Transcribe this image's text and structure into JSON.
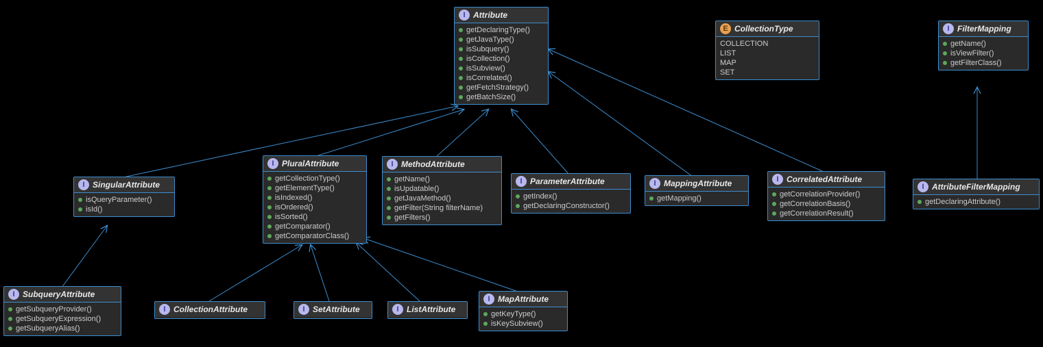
{
  "attribute": {
    "name": "Attribute",
    "m": [
      "getDeclaringType()",
      "getJavaType()",
      "isSubquery()",
      "isCollection()",
      "isSubview()",
      "isCorrelated()",
      "getFetchStrategy()",
      "getBatchSize()"
    ]
  },
  "collectionType": {
    "name": "CollectionType",
    "m": [
      "COLLECTION",
      "LIST",
      "MAP",
      "SET"
    ]
  },
  "filterMapping": {
    "name": "FilterMapping",
    "m": [
      "getName()",
      "isViewFilter()",
      "getFilterClass()"
    ]
  },
  "singularAttribute": {
    "name": "SingularAttribute",
    "m": [
      "isQueryParameter()",
      "isId()"
    ]
  },
  "pluralAttribute": {
    "name": "PluralAttribute",
    "m": [
      "getCollectionType()",
      "getElementType()",
      "isIndexed()",
      "isOrdered()",
      "isSorted()",
      "getComparator()",
      "getComparatorClass()"
    ]
  },
  "methodAttribute": {
    "name": "MethodAttribute",
    "m": [
      "getName()",
      "isUpdatable()",
      "getJavaMethod()",
      "getFilter(String filterName)",
      "getFilters()"
    ]
  },
  "parameterAttribute": {
    "name": "ParameterAttribute",
    "m": [
      "getIndex()",
      "getDeclaringConstructor()"
    ]
  },
  "mappingAttribute": {
    "name": "MappingAttribute",
    "m": [
      "getMapping()"
    ]
  },
  "correlatedAttribute": {
    "name": "CorrelatedAttribute",
    "m": [
      "getCorrelationProvider()",
      "getCorrelationBasis()",
      "getCorrelationResult()"
    ]
  },
  "attributeFilterMapping": {
    "name": "AttributeFilterMapping",
    "m": [
      "getDeclaringAttribute()"
    ]
  },
  "subqueryAttribute": {
    "name": "SubqueryAttribute",
    "m": [
      "getSubqueryProvider()",
      "getSubqueryExpression()",
      "getSubqueryAlias()"
    ]
  },
  "collectionAttribute": {
    "name": "CollectionAttribute"
  },
  "setAttribute": {
    "name": "SetAttribute"
  },
  "listAttribute": {
    "name": "ListAttribute"
  },
  "mapAttribute": {
    "name": "MapAttribute",
    "m": [
      "getKeyType()",
      "isKeySubview()"
    ]
  }
}
